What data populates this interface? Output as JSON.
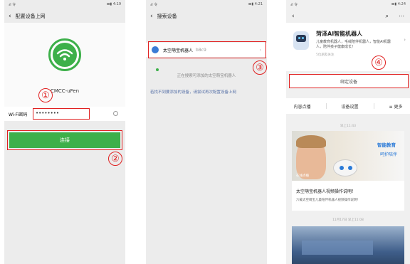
{
  "phone1": {
    "status": {
      "signal": "ᵢıl 令",
      "battery": "▬▮ 4:19"
    },
    "nav_title": "配置设备上网",
    "ssid": "CMCC-uFen",
    "password_label": "Wi-Fi密码",
    "password_value": "••••••••",
    "connect_label": "连接",
    "annot_1": "①",
    "annot_2": "②"
  },
  "phone2": {
    "status": {
      "signal": "ᵢıl 令",
      "battery": "▬▮ 4:21"
    },
    "nav_title": "搜索设备",
    "device_name": "太空萌宝机器人",
    "device_id": "b8c9",
    "searching_text": "正在搜索可添加的太空萌宝机器人",
    "hint_text": "若找不到要添加的设备，请尝试再次配置设备上网",
    "annot_3": "③"
  },
  "phone3": {
    "status": {
      "signal": "ᵢıl 令",
      "battery": "▬▮ 4:24"
    },
    "profile_name": "菏泽AI智能机器人",
    "profile_desc": "儿童教育机器人，毛绒陪伴机器人，智能AI机器人，陪伴孩子健康成长！",
    "profile_follow": "5位朋友关注",
    "bind_label": "绑定设备",
    "tabs": [
      "内容点播",
      "设备设置",
      "更多"
    ],
    "time1": "早上11:43",
    "card_tag1": "智能教育",
    "card_tag2": "呵护陪伴",
    "card_video_tag": "在线点播",
    "card_title": "太空萌宝机器人视频操作说明！",
    "card_sub": "六载太空萌宝儿童陪伴机器人视频操作说明！",
    "time2": "11月17日 早上11:08",
    "annot_4": "④"
  }
}
